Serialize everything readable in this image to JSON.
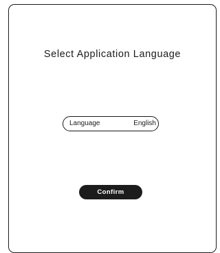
{
  "dialog": {
    "title": "Select Application Language",
    "language_selector": {
      "label": "Language",
      "value": "English"
    },
    "confirm_label": "Confirm"
  },
  "colors": {
    "border": "#1a1a1a",
    "button_bg": "#1c1c1c",
    "button_text": "#ffffff",
    "background": "#ffffff"
  }
}
